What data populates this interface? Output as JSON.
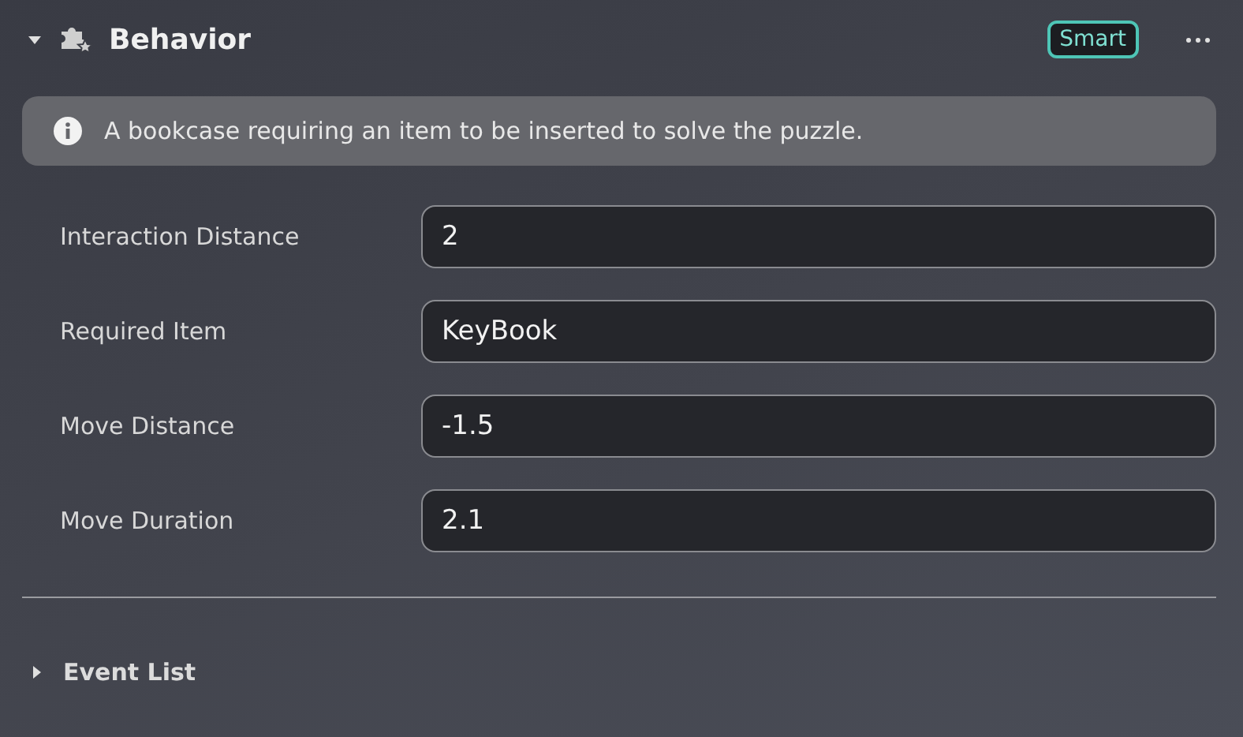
{
  "section": {
    "title": "Behavior",
    "expanded": true,
    "badge": "Smart"
  },
  "info": "A bookcase requiring an item to be inserted to solve the puzzle.",
  "fields": [
    {
      "label": "Interaction Distance",
      "value": "2"
    },
    {
      "label": "Required Item",
      "value": "KeyBook"
    },
    {
      "label": "Move Distance",
      "value": "-1.5"
    },
    {
      "label": "Move Duration",
      "value": "2.1"
    }
  ],
  "event_list": {
    "title": "Event List",
    "expanded": false
  }
}
